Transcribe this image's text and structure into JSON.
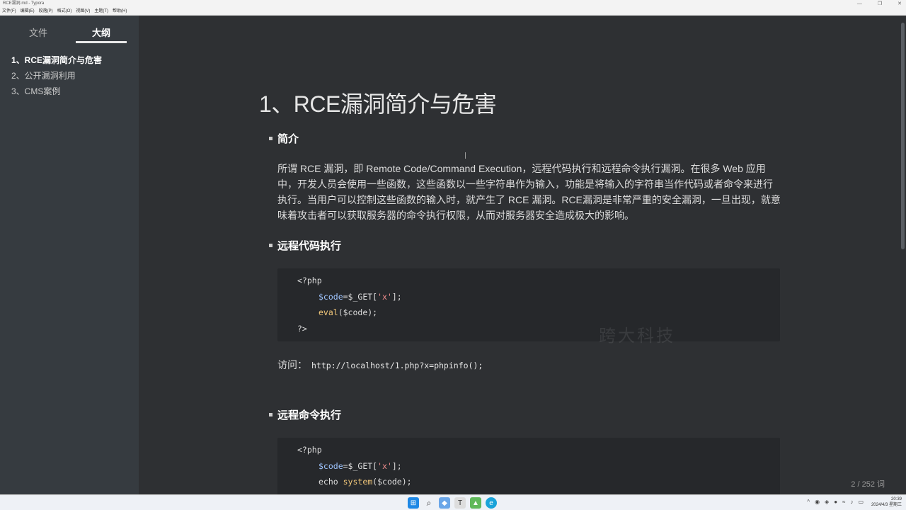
{
  "window": {
    "title": "RCE漏洞.md - Typora",
    "controls": [
      "—",
      "❐",
      "✕"
    ]
  },
  "menu": [
    "文件(F)",
    "编辑(E)",
    "段落(P)",
    "格式(O)",
    "视图(V)",
    "主题(T)",
    "帮助(H)"
  ],
  "sidebar": {
    "tab_files": "文件",
    "tab_outline": "大纲",
    "items": [
      {
        "label": "1、RCE漏洞简介与危害"
      },
      {
        "label": "2、公开漏洞利用"
      },
      {
        "label": "3、CMS案例"
      }
    ],
    "footer_back": "‹",
    "footer_source": "</>"
  },
  "doc": {
    "h1": "1、RCE漏洞简介与危害",
    "sec1": "简介",
    "para": "所谓 RCE 漏洞，即 Remote Code/Command Execution，远程代码执行和远程命令执行漏洞。在很多 Web 应用中，开发人员会使用一些函数，这些函数以一些字符串作为输入，功能是将输入的字符串当作代码或者命令来进行执行。当用户可以控制这些函数的输入时，就产生了 RCE 漏洞。RCE漏洞是非常严重的安全漏洞，一旦出现，就意味着攻击者可以获取服务器的命令执行权限，从而对服务器安全造成极大的影响。",
    "sec2": "远程代码执行",
    "code1": {
      "open": "<?php",
      "l2_var": "$code",
      "l2_mid": "=$_GET[",
      "l2_str": "'x'",
      "l2_end": "];",
      "l3_fn": "eval",
      "l3_args": "($code);",
      "close": "?>"
    },
    "visit_label": "访问：",
    "visit_url": "http://localhost/1.php?x=phpinfo();",
    "sec3": "远程命令执行",
    "code2": {
      "open": "<?php",
      "l2_var": "$code",
      "l2_mid": "=$_GET[",
      "l2_str": "'x'",
      "l2_end": "];",
      "l3_a": "echo ",
      "l3_fn": "system",
      "l3_args": "($code);"
    },
    "watermark": "跨大科技",
    "wordcount": "2 / 252 词"
  },
  "taskbar": {
    "time": "20:39",
    "date": "2024/4/3 星期三"
  },
  "colors": {
    "sidebar_bg": "#363b40",
    "editor_bg": "#2e3033",
    "code_bg": "#26282b"
  }
}
